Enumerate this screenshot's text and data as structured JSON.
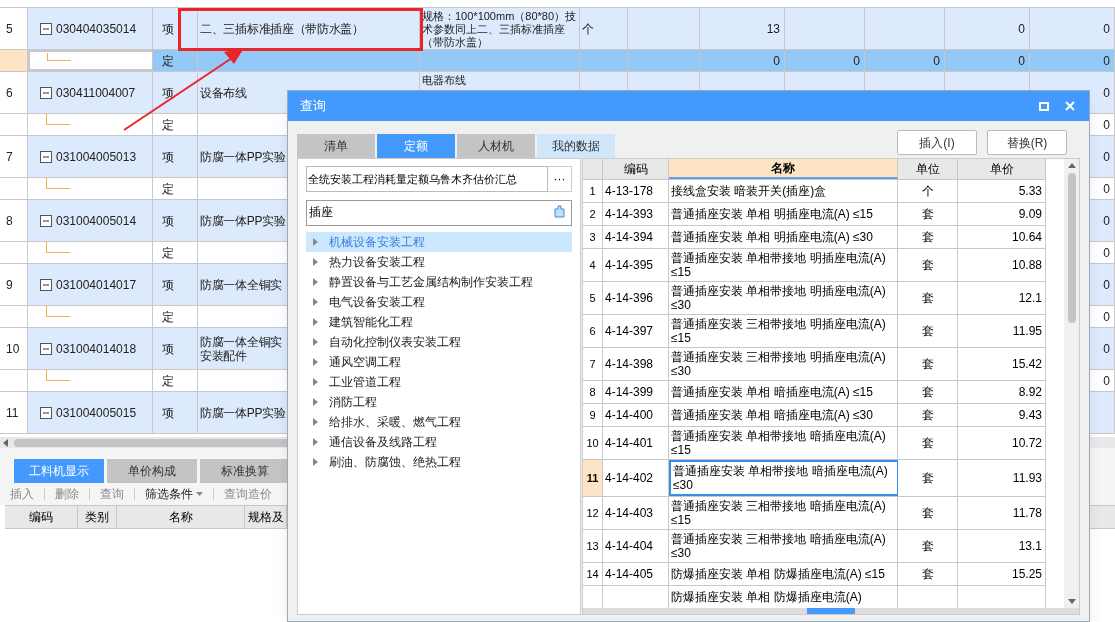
{
  "table": {
    "rows": [
      {
        "kind": "item",
        "selected": false,
        "num": "5",
        "code": "030404035014",
        "type": "项",
        "name": "二、三插标准插座（带防水盖）",
        "spec": "规格：100*100mm（80*80）技术参数同上二、三插标准插座（带防水盖）",
        "unit": "个",
        "values": {
          "column_8": "13",
          "column_11": "0",
          "column_12": "0"
        }
      },
      {
        "kind": "sub",
        "selected": true,
        "type": "定",
        "values": {
          "column_8": "0",
          "column_9": "0",
          "column_10": "0",
          "column_11": "0",
          "column_12": "0"
        }
      },
      {
        "kind": "item",
        "selected": false,
        "num": "6",
        "code": "030411004007",
        "type": "项",
        "name": "设备布线",
        "spec": "电器布线",
        "values": {
          "column_12": "0"
        }
      },
      {
        "kind": "sub",
        "selected": false,
        "type": "定",
        "values": {
          "column_12": "0"
        }
      },
      {
        "kind": "item",
        "selected": false,
        "num": "7",
        "code": "031004005013",
        "type": "项",
        "name": "防腐一体PP实验",
        "values": {
          "column_12": "0"
        }
      },
      {
        "kind": "sub",
        "selected": false,
        "type": "定",
        "values": {
          "column_12": "0"
        }
      },
      {
        "kind": "item",
        "selected": false,
        "num": "8",
        "code": "031004005014",
        "type": "项",
        "name": "防腐一体PP实验",
        "values": {
          "column_12": "0"
        }
      },
      {
        "kind": "sub",
        "selected": false,
        "type": "定",
        "values": {
          "column_12": "0"
        }
      },
      {
        "kind": "item",
        "selected": false,
        "num": "9",
        "code": "031004014017",
        "type": "项",
        "name": "防腐一体全铜实",
        "values": {
          "column_12": "0"
        }
      },
      {
        "kind": "sub",
        "selected": false,
        "type": "定",
        "values": {
          "column_12": "0"
        }
      },
      {
        "kind": "item",
        "selected": false,
        "num": "10",
        "code": "031004014018",
        "type": "项",
        "name": "防腐一体全铜实安装配件",
        "values": {
          "column_12": "0"
        }
      },
      {
        "kind": "sub",
        "selected": false,
        "type": "定",
        "values": {
          "column_12": "0"
        }
      },
      {
        "kind": "item",
        "selected": false,
        "num": "11",
        "code": "031004005015",
        "type": "项",
        "name": "防腐一体PP实验"
      }
    ]
  },
  "bottom_panel": {
    "tabs": [
      {
        "label": "工料机显示",
        "selected": true
      },
      {
        "label": "单价构成",
        "selected": false
      },
      {
        "label": "标准换算",
        "selected": false
      }
    ],
    "toolbar": [
      {
        "label": "插入",
        "kind": "plain"
      },
      {
        "label": "删除",
        "kind": "plain"
      },
      {
        "label": "查询",
        "kind": "plain"
      },
      {
        "label": "筛选条件",
        "kind": "dropdown"
      },
      {
        "label": "查询造价",
        "kind": "plain"
      }
    ],
    "columns": [
      "编码",
      "类别",
      "名称",
      "规格及"
    ]
  },
  "dialog": {
    "title": "查询",
    "tabs": [
      {
        "label": "清单",
        "selected": false,
        "hovered": false
      },
      {
        "label": "定额",
        "selected": true,
        "hovered": false
      },
      {
        "label": "人材机",
        "selected": false,
        "hovered": false
      },
      {
        "label": "我的数据",
        "selected": false,
        "hovered": true
      }
    ],
    "buttons": [
      "插入(I)",
      "替换(R)"
    ],
    "library": "全统安装工程消耗量定额乌鲁木齐估价汇总",
    "library_button": "···",
    "search": "插座",
    "tree": [
      {
        "label": "机械设备安装工程",
        "selected": true
      },
      {
        "label": "热力设备安装工程",
        "selected": false
      },
      {
        "label": "静置设备与工艺金属结构制作安装工程",
        "selected": false
      },
      {
        "label": "电气设备安装工程",
        "selected": false
      },
      {
        "label": "建筑智能化工程",
        "selected": false
      },
      {
        "label": "自动化控制仪表安装工程",
        "selected": false
      },
      {
        "label": "通风空调工程",
        "selected": false
      },
      {
        "label": "工业管道工程",
        "selected": false
      },
      {
        "label": "消防工程",
        "selected": false
      },
      {
        "label": "给排水、采暖、燃气工程",
        "selected": false
      },
      {
        "label": "通信设备及线路工程",
        "selected": false
      },
      {
        "label": "刷油、防腐蚀、绝热工程",
        "selected": false
      }
    ],
    "grid": {
      "columns": [
        "编码",
        "名称",
        "单位",
        "单价"
      ],
      "rows": [
        {
          "num": "1",
          "code": "4-13-178",
          "name": "接线盒安装 暗装开关(插座)盒",
          "unit": "个",
          "price": "5.33",
          "selected": false
        },
        {
          "num": "2",
          "code": "4-14-393",
          "name": "普通插座安装 单相 明插座电流(A) ≤15",
          "unit": "套",
          "price": "9.09",
          "selected": false
        },
        {
          "num": "3",
          "code": "4-14-394",
          "name": "普通插座安装 单相 明插座电流(A) ≤30",
          "unit": "套",
          "price": "10.64",
          "selected": false
        },
        {
          "num": "4",
          "code": "4-14-395",
          "name": "普通插座安装 单相带接地 明插座电流(A) ≤15",
          "unit": "套",
          "price": "10.88",
          "selected": false
        },
        {
          "num": "5",
          "code": "4-14-396",
          "name": "普通插座安装 单相带接地 明插座电流(A) ≤30",
          "unit": "套",
          "price": "12.1",
          "selected": false
        },
        {
          "num": "6",
          "code": "4-14-397",
          "name": "普通插座安装 三相带接地 明插座电流(A) ≤15",
          "unit": "套",
          "price": "11.95",
          "selected": false
        },
        {
          "num": "7",
          "code": "4-14-398",
          "name": "普通插座安装 三相带接地 明插座电流(A) ≤30",
          "unit": "套",
          "price": "15.42",
          "selected": false
        },
        {
          "num": "8",
          "code": "4-14-399",
          "name": "普通插座安装 单相 暗插座电流(A) ≤15",
          "unit": "套",
          "price": "8.92",
          "selected": false
        },
        {
          "num": "9",
          "code": "4-14-400",
          "name": "普通插座安装 单相 暗插座电流(A) ≤30",
          "unit": "套",
          "price": "9.43",
          "selected": false
        },
        {
          "num": "10",
          "code": "4-14-401",
          "name": "普通插座安装 单相带接地 暗插座电流(A) ≤15",
          "unit": "套",
          "price": "10.72",
          "selected": false
        },
        {
          "num": "11",
          "code": "4-14-402",
          "name": "普通插座安装 单相带接地 暗插座电流(A) ≤30",
          "unit": "套",
          "price": "11.93",
          "selected": true
        },
        {
          "num": "12",
          "code": "4-14-403",
          "name": "普通插座安装 三相带接地 暗插座电流(A) ≤15",
          "unit": "套",
          "price": "11.78",
          "selected": false
        },
        {
          "num": "13",
          "code": "4-14-404",
          "name": "普通插座安装 三相带接地 暗插座电流(A) ≤30",
          "unit": "套",
          "price": "13.1",
          "selected": false
        },
        {
          "num": "14",
          "code": "4-14-405",
          "name": "防爆插座安装 单相 防爆插座电流(A) ≤15",
          "unit": "套",
          "price": "15.25",
          "selected": false
        },
        {
          "name": "防爆插座安装 单相 防爆插座电流(A)",
          "selected": false
        }
      ]
    }
  }
}
